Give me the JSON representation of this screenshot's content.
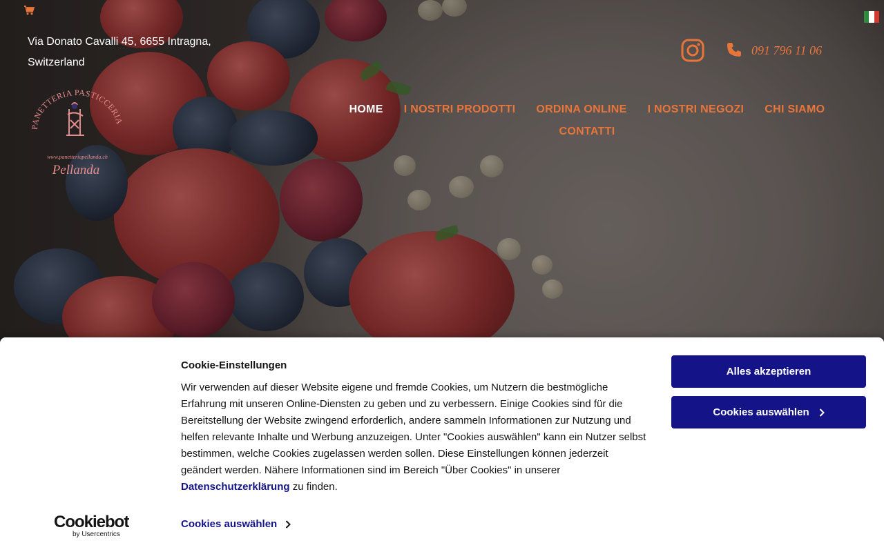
{
  "header": {
    "address": "Via Donato Cavalli 45, 6655 Intragna, Switzerland",
    "phone": "091 796 11 06",
    "logo": {
      "arc_text": "PANETTERIA PASTICCERIA",
      "url_text": "www.panetteriapellanda.ch",
      "name": "Pellanda"
    },
    "icons": {
      "cart": "shopping-cart-icon",
      "flag": "italian-flag-icon",
      "instagram": "instagram-icon",
      "phone": "phone-icon"
    }
  },
  "nav": {
    "items": [
      {
        "label": "HOME"
      },
      {
        "label": "I NOSTRI PRODOTTI"
      },
      {
        "label": "ORDINA ONLINE"
      },
      {
        "label": "I NOSTRI NEGOZI"
      },
      {
        "label": "CHI SIAMO"
      },
      {
        "label": "CONTATTI"
      }
    ],
    "active": "HOME"
  },
  "cookie_banner": {
    "brand": "Cookiebot",
    "brand_sub": "by Usercentrics",
    "title": "Cookie-Einstellungen",
    "text": "Wir verwenden auf dieser Website eigene und fremde Cookies, um Nutzern die bestmögliche Erfahrung mit unseren Online-Diensten zu geben und zu verbessern. Einige Cookies sind für die Bereitstellung der Website zwingend erforderlich, andere sammeln Informationen zur Nutzung und helfen relevante Inhalte und Werbung anzuzeigen. Unter \"Cookies auswählen\" kann ein Nutzer selbst bestimmen, welche Cookies zugelassen werden sollen. Diese Einstellungen können jederzeit geändert werden. Nähere Informationen sind im Bereich \"Über Cookies\" in unserer",
    "privacy_link": "Datenschutzerklärung",
    "text_end": "zu finden.",
    "select_link": "Cookies auswählen",
    "accept_all": "Alles akzeptieren",
    "select_button": "Cookies auswählen"
  },
  "colors": {
    "accent": "#e8753a",
    "cookie_button": "#141488",
    "nav_active": "#ffffff"
  }
}
